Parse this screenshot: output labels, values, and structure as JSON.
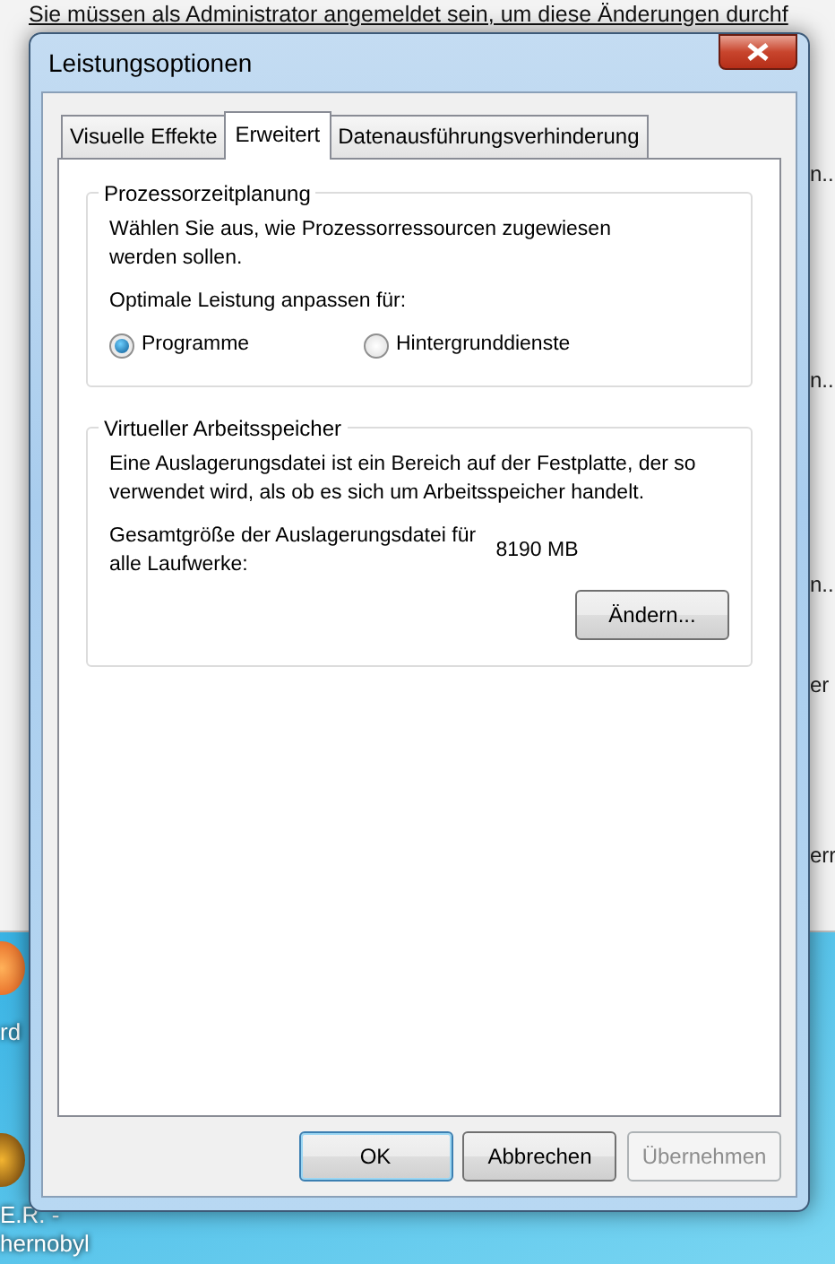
{
  "background": {
    "header_text": "Sie müssen als Administrator angemeldet sein, um diese Änderungen durchf",
    "side_fragments": [
      "n...",
      "n...",
      "n...",
      "er",
      "err"
    ]
  },
  "desktop_icons": [
    {
      "label_lines": [
        "rd"
      ]
    },
    {
      "label_lines": [
        "E.R. -",
        "hernobyl"
      ]
    }
  ],
  "window": {
    "title": "Leistungsoptionen"
  },
  "tabs": [
    {
      "label": "Visuelle Effekte",
      "selected": false
    },
    {
      "label": "Erweitert",
      "selected": true
    },
    {
      "label": "Datenausführungsverhinderung",
      "selected": false
    }
  ],
  "scheduling": {
    "title": "Prozessorzeitplanung",
    "description": "Wählen Sie aus, wie Prozessorressourcen zugewiesen werden sollen.",
    "prompt": "Optimale Leistung anpassen für:",
    "options": [
      {
        "label": "Programme",
        "selected": true
      },
      {
        "label": "Hintergrunddienste",
        "selected": false
      }
    ]
  },
  "virtual_memory": {
    "title": "Virtueller Arbeitsspeicher",
    "description": "Eine Auslagerungsdatei ist ein Bereich auf der Festplatte, der so verwendet wird, als ob es sich um Arbeitsspeicher handelt.",
    "size_label": "Gesamtgröße der Auslagerungsdatei für alle Laufwerke:",
    "size_value": "8190 MB",
    "button": "Ändern..."
  },
  "buttons": [
    {
      "label": "OK",
      "default": true,
      "disabled": false
    },
    {
      "label": "Abbrechen",
      "default": false,
      "disabled": false
    },
    {
      "label": "Übernehmen",
      "default": false,
      "disabled": true
    }
  ]
}
